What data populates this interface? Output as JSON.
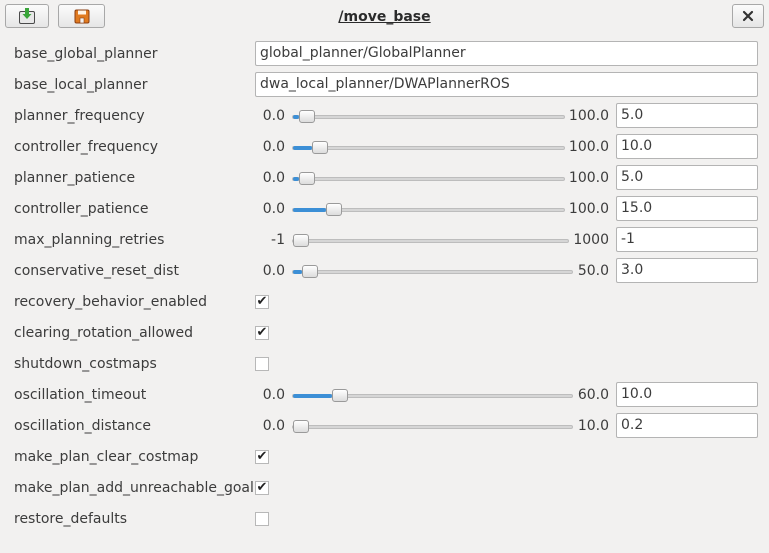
{
  "window": {
    "title": "/move_base",
    "load_icon": "download-icon",
    "save_icon": "save-icon",
    "close_icon": "close-icon"
  },
  "params": [
    {
      "type": "text",
      "name": "base_global_planner",
      "value": "global_planner/GlobalPlanner"
    },
    {
      "type": "text",
      "name": "base_local_planner",
      "value": "dwa_local_planner/DWAPlannerROS"
    },
    {
      "type": "slider",
      "name": "planner_frequency",
      "min": "0.0",
      "max": "100.0",
      "value": "5.0",
      "fraction": 0.05
    },
    {
      "type": "slider",
      "name": "controller_frequency",
      "min": "0.0",
      "max": "100.0",
      "value": "10.0",
      "fraction": 0.1
    },
    {
      "type": "slider",
      "name": "planner_patience",
      "min": "0.0",
      "max": "100.0",
      "value": "5.0",
      "fraction": 0.05
    },
    {
      "type": "slider",
      "name": "controller_patience",
      "min": "0.0",
      "max": "100.0",
      "value": "15.0",
      "fraction": 0.15
    },
    {
      "type": "slider",
      "name": "max_planning_retries",
      "min": "-1",
      "max": "1000",
      "value": "-1",
      "fraction": 0.0
    },
    {
      "type": "slider",
      "name": "conservative_reset_dist",
      "min": "0.0",
      "max": "50.0",
      "value": "3.0",
      "fraction": 0.06
    },
    {
      "type": "check",
      "name": "recovery_behavior_enabled",
      "checked": true
    },
    {
      "type": "check",
      "name": "clearing_rotation_allowed",
      "checked": true
    },
    {
      "type": "check",
      "name": "shutdown_costmaps",
      "checked": false
    },
    {
      "type": "slider",
      "name": "oscillation_timeout",
      "min": "0.0",
      "max": "60.0",
      "value": "10.0",
      "fraction": 0.1667
    },
    {
      "type": "slider",
      "name": "oscillation_distance",
      "min": "0.0",
      "max": "10.0",
      "value": "0.2",
      "fraction": 0.02
    },
    {
      "type": "check",
      "name": "make_plan_clear_costmap",
      "checked": true
    },
    {
      "type": "check",
      "name": "make_plan_add_unreachable_goal",
      "checked": true
    },
    {
      "type": "check",
      "name": "restore_defaults",
      "checked": false
    }
  ],
  "colors": {
    "accent": "#3c8fd6",
    "background": "#f2f1f0"
  }
}
